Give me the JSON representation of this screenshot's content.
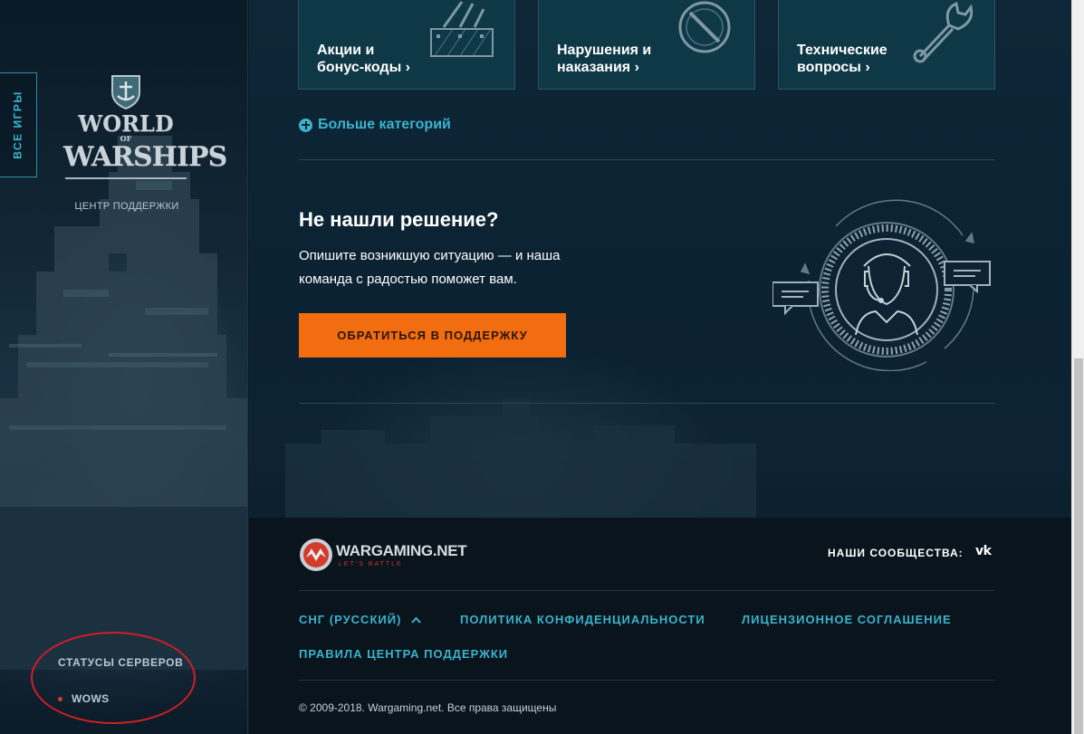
{
  "sidebar": {
    "all_games_label": "ВСЕ ИГРЫ",
    "logo_line1": "WORLD",
    "logo_of": "OF",
    "logo_line2": "WARSHIPS",
    "support_center_label": "ЦЕНТР ПОДДЕРЖКИ",
    "server_status_title": "СТАТУСЫ СЕРВЕРОВ",
    "servers": [
      {
        "name": "WOWS",
        "status_color": "#d33c2a"
      }
    ]
  },
  "categories": [
    {
      "label": "Акции и\nбонус-коды ›",
      "icon": "clapper-board-icon"
    },
    {
      "label": "Нарушения и\nнаказания ›",
      "icon": "prohibited-icon"
    },
    {
      "label": "Технические\nвопросы ›",
      "icon": "wrench-icon"
    }
  ],
  "more_categories_label": "Больше категорий",
  "not_found": {
    "title": "Не нашли решение?",
    "description": "Опишите возникшую ситуацию — и наша команда с радостью поможет вам.",
    "button_label": "ОБРАТИТЬСЯ В ПОДДЕРЖКУ"
  },
  "footer": {
    "brand": "WARGAMING.NET",
    "slogan": "LET'S BATTLE",
    "communities_label": "НАШИ СООБЩЕСТВА:",
    "vk_label": "vk",
    "region_label": "СНГ (РУССКИЙ)",
    "privacy_label": "ПОЛИТИКА КОНФИДЕНЦИАЛЬНОСТИ",
    "license_label": "ЛИЦЕНЗИОННОЕ СОГЛАШЕНИЕ",
    "rules_label": "ПРАВИЛА ЦЕНТРА ПОДДЕРЖКИ",
    "copyright": "© 2009-2018. Wargaming.net. Все права защищены"
  },
  "colors": {
    "accent": "#3bb4cc",
    "button": "#f26d10",
    "annotation": "#d01e24"
  }
}
